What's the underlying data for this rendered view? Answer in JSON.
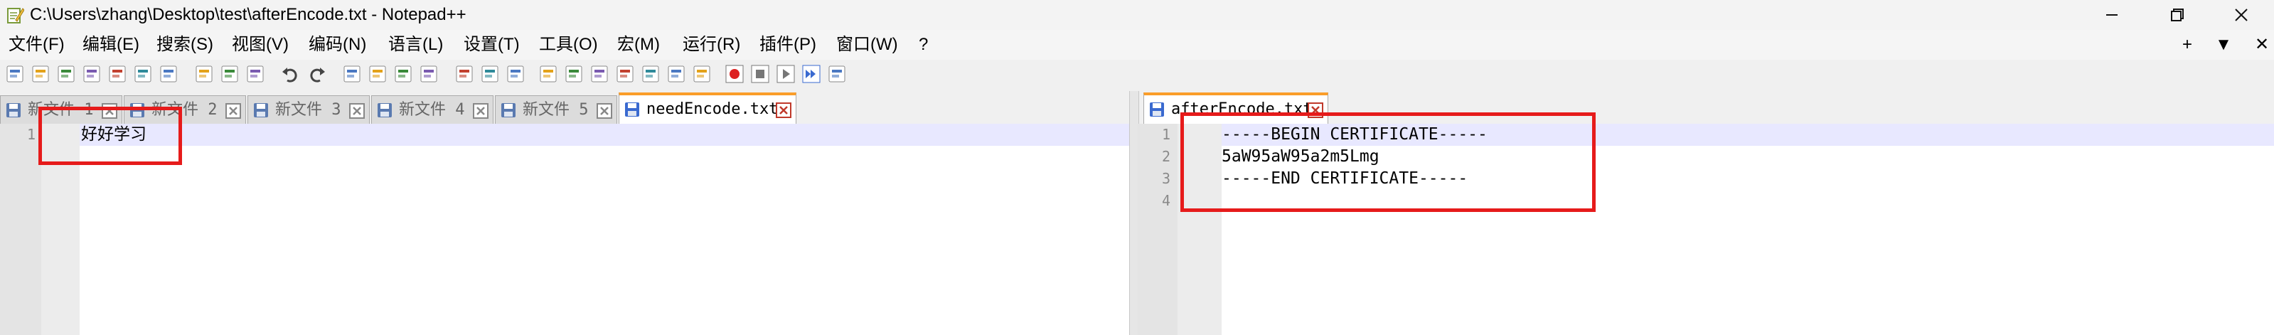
{
  "window": {
    "title": "C:\\Users\\zhang\\Desktop\\test\\afterEncode.txt - Notepad++",
    "controls": [
      "minimize",
      "maximize",
      "close"
    ]
  },
  "menu": {
    "items": [
      "文件(F)",
      "编辑(E)",
      "搜索(S)",
      "视图(V)",
      "编码(N)",
      "语言(L)",
      "设置(T)",
      "工具(O)",
      "宏(M)",
      "运行(R)",
      "插件(P)",
      "窗口(W)",
      "?"
    ],
    "right_items": [
      "+",
      "▼",
      "✕"
    ]
  },
  "toolbar": {
    "icons": [
      "new-file-icon",
      "open-file-icon",
      "save-icon",
      "save-all-icon",
      "close-icon",
      "close-all-icon",
      "print-icon",
      "cut-icon",
      "copy-icon",
      "paste-icon",
      "undo-icon",
      "redo-icon",
      "find-icon",
      "replace-icon",
      "zoom-in-icon",
      "zoom-out-icon",
      "sync-v-icon",
      "sync-h-icon",
      "word-wrap-icon",
      "show-all-chars-icon",
      "indent-guide-icon",
      "lang-icon",
      "doc-map-icon",
      "function-list-icon",
      "folder-workspace-icon",
      "monitor-icon",
      "record-macro-icon",
      "stop-macro-icon",
      "play-macro-icon",
      "run-macro-multiple-icon",
      "save-macro-icon"
    ]
  },
  "left_pane": {
    "tabs": [
      {
        "label": "新文件 1",
        "active": false
      },
      {
        "label": "新文件 2",
        "active": false
      },
      {
        "label": "新文件 3",
        "active": false
      },
      {
        "label": "新文件 4",
        "active": false
      },
      {
        "label": "新文件 5",
        "active": false
      },
      {
        "label": "needEncode.txt",
        "active": true
      }
    ],
    "lines": [
      {
        "no": "1",
        "text": "好好学习"
      }
    ]
  },
  "right_pane": {
    "tabs": [
      {
        "label": "afterEncode.txt",
        "active": true
      }
    ],
    "lines": [
      {
        "no": "1",
        "text": "-----BEGIN CERTIFICATE-----"
      },
      {
        "no": "2",
        "text": "5aW95aW95a2m5Lmg"
      },
      {
        "no": "3",
        "text": "-----END CERTIFICATE-----"
      },
      {
        "no": "4",
        "text": ""
      }
    ]
  },
  "colors": {
    "annotation": "#e61b1b",
    "active_tab_accent": "#fa9d29",
    "current_line": "#e8e8ff"
  }
}
